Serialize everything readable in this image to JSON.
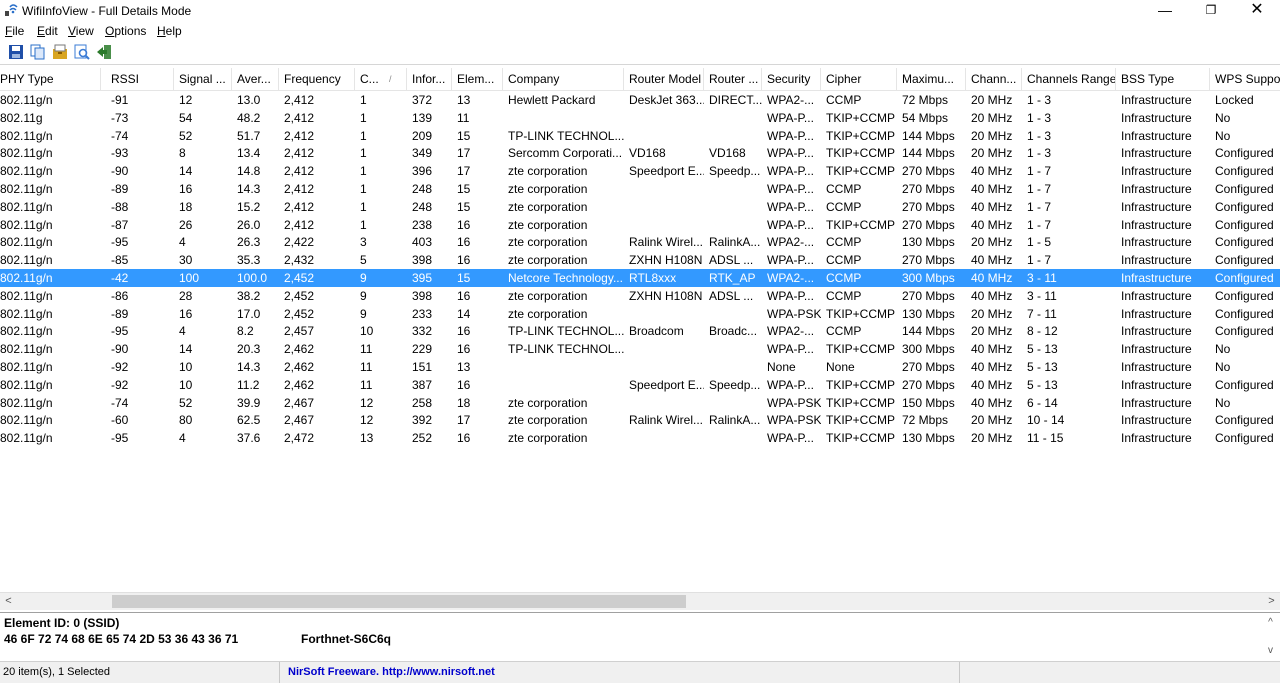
{
  "window": {
    "title": "WifiInfoView  -  Full Details Mode",
    "minimize_glyph": "—",
    "maximize_glyph": "❐",
    "close_glyph": "✕"
  },
  "menu": [
    {
      "label": "File",
      "key": "F",
      "rest": "ile"
    },
    {
      "label": "Edit",
      "key": "E",
      "rest": "dit"
    },
    {
      "label": "View",
      "key": "V",
      "rest": "iew"
    },
    {
      "label": "Options",
      "key": "O",
      "rest": "ptions"
    },
    {
      "label": "Help",
      "key": "H",
      "rest": "elp"
    }
  ],
  "toolbar": {
    "icons": [
      "save-icon",
      "copy-icon",
      "properties-icon",
      "find-icon",
      "exit-icon"
    ],
    "colors": {
      "save": "#1f4fa8",
      "copy": "#2a6fc9",
      "properties": "#d9a520",
      "find": "#3a7bd5",
      "exit": "#2b7a2b"
    }
  },
  "colors": {
    "selection": "#3399ff",
    "header_border": "#e5e5e5",
    "statusbar": "#f0f0f0",
    "link": "#0000cc"
  },
  "table": {
    "columns": [
      "PHY Type",
      "RSSI",
      "Signal ...",
      "Aver...",
      "Frequency",
      "C...",
      "Infor...",
      "Elem...",
      "Company",
      "Router Model",
      "Router ...",
      "Security",
      "Cipher",
      "Maximu...",
      "Chann...",
      "Channels Range",
      "BSS Type",
      "WPS Support"
    ],
    "sort_indicator": "/",
    "rows": [
      {
        "selected": false,
        "cells": [
          "802.11g/n",
          "-91",
          "12",
          "13.0",
          "2,412",
          "1",
          "372",
          "13",
          "Hewlett Packard",
          "DeskJet 363...",
          "DIRECT...",
          "WPA2-...",
          "CCMP",
          "72 Mbps",
          "20 MHz",
          "1 - 3",
          "Infrastructure",
          "Locked"
        ]
      },
      {
        "selected": false,
        "cells": [
          "802.11g",
          "-73",
          "54",
          "48.2",
          "2,412",
          "1",
          "139",
          "11",
          "",
          "",
          "",
          "WPA-P...",
          "TKIP+CCMP",
          "54 Mbps",
          "20 MHz",
          "1 - 3",
          "Infrastructure",
          "No"
        ]
      },
      {
        "selected": false,
        "cells": [
          "802.11g/n",
          "-74",
          "52",
          "51.7",
          "2,412",
          "1",
          "209",
          "15",
          "TP-LINK TECHNOL...",
          "",
          "",
          "WPA-P...",
          "TKIP+CCMP",
          "144 Mbps",
          "20 MHz",
          "1 - 3",
          "Infrastructure",
          "No"
        ]
      },
      {
        "selected": false,
        "cells": [
          "802.11g/n",
          "-93",
          "8",
          "13.4",
          "2,412",
          "1",
          "349",
          "17",
          "Sercomm Corporati...",
          "VD168",
          "VD168",
          "WPA-P...",
          "TKIP+CCMP",
          "144 Mbps",
          "20 MHz",
          "1 - 3",
          "Infrastructure",
          "Configured"
        ]
      },
      {
        "selected": false,
        "cells": [
          "802.11g/n",
          "-90",
          "14",
          "14.8",
          "2,412",
          "1",
          "396",
          "17",
          "zte corporation",
          "Speedport E...",
          "Speedp...",
          "WPA-P...",
          "TKIP+CCMP",
          "270 Mbps",
          "40 MHz",
          "1 - 7",
          "Infrastructure",
          "Configured"
        ]
      },
      {
        "selected": false,
        "cells": [
          "802.11g/n",
          "-89",
          "16",
          "14.3",
          "2,412",
          "1",
          "248",
          "15",
          "zte corporation",
          "",
          "",
          "WPA-P...",
          "CCMP",
          "270 Mbps",
          "40 MHz",
          "1 - 7",
          "Infrastructure",
          "Configured"
        ]
      },
      {
        "selected": false,
        "cells": [
          "802.11g/n",
          "-88",
          "18",
          "15.2",
          "2,412",
          "1",
          "248",
          "15",
          "zte corporation",
          "",
          "",
          "WPA-P...",
          "CCMP",
          "270 Mbps",
          "40 MHz",
          "1 - 7",
          "Infrastructure",
          "Configured"
        ]
      },
      {
        "selected": false,
        "cells": [
          "802.11g/n",
          "-87",
          "26",
          "26.0",
          "2,412",
          "1",
          "238",
          "16",
          "zte corporation",
          "",
          "",
          "WPA-P...",
          "TKIP+CCMP",
          "270 Mbps",
          "40 MHz",
          "1 - 7",
          "Infrastructure",
          "Configured"
        ]
      },
      {
        "selected": false,
        "cells": [
          "802.11g/n",
          "-95",
          "4",
          "26.3",
          "2,422",
          "3",
          "403",
          "16",
          "zte corporation",
          "Ralink Wirel...",
          "RalinkA...",
          "WPA2-...",
          "CCMP",
          "130 Mbps",
          "20 MHz",
          "1 - 5",
          "Infrastructure",
          "Configured"
        ]
      },
      {
        "selected": false,
        "cells": [
          "802.11g/n",
          "-85",
          "30",
          "35.3",
          "2,432",
          "5",
          "398",
          "16",
          "zte corporation",
          "ZXHN H108N",
          "ADSL ...",
          "WPA-P...",
          "CCMP",
          "270 Mbps",
          "40 MHz",
          "1 - 7",
          "Infrastructure",
          "Configured"
        ]
      },
      {
        "selected": true,
        "cells": [
          "802.11g/n",
          "-42",
          "100",
          "100.0",
          "2,452",
          "9",
          "395",
          "15",
          "Netcore Technology...",
          "RTL8xxx",
          "RTK_AP",
          "WPA2-...",
          "CCMP",
          "300 Mbps",
          "40 MHz",
          "3 - 11",
          "Infrastructure",
          "Configured"
        ]
      },
      {
        "selected": false,
        "cells": [
          "802.11g/n",
          "-86",
          "28",
          "38.2",
          "2,452",
          "9",
          "398",
          "16",
          "zte corporation",
          "ZXHN H108N",
          "ADSL ...",
          "WPA-P...",
          "CCMP",
          "270 Mbps",
          "40 MHz",
          "3 - 11",
          "Infrastructure",
          "Configured"
        ]
      },
      {
        "selected": false,
        "cells": [
          "802.11g/n",
          "-89",
          "16",
          "17.0",
          "2,452",
          "9",
          "233",
          "14",
          "zte corporation",
          "",
          "",
          "WPA-PSK",
          "TKIP+CCMP",
          "130 Mbps",
          "20 MHz",
          "7 - 11",
          "Infrastructure",
          "Configured"
        ]
      },
      {
        "selected": false,
        "cells": [
          "802.11g/n",
          "-95",
          "4",
          "8.2",
          "2,457",
          "10",
          "332",
          "16",
          "TP-LINK TECHNOL...",
          "Broadcom",
          "Broadc...",
          "WPA2-...",
          "CCMP",
          "144 Mbps",
          "20 MHz",
          "8 - 12",
          "Infrastructure",
          "Configured"
        ]
      },
      {
        "selected": false,
        "cells": [
          "802.11g/n",
          "-90",
          "14",
          "20.3",
          "2,462",
          "11",
          "229",
          "16",
          "TP-LINK TECHNOL...",
          "",
          "",
          "WPA-P...",
          "TKIP+CCMP",
          "300 Mbps",
          "40 MHz",
          "5 - 13",
          "Infrastructure",
          "No"
        ]
      },
      {
        "selected": false,
        "cells": [
          "802.11g/n",
          "-92",
          "10",
          "14.3",
          "2,462",
          "11",
          "151",
          "13",
          "",
          "",
          "",
          "None",
          "None",
          "270 Mbps",
          "40 MHz",
          "5 - 13",
          "Infrastructure",
          "No"
        ]
      },
      {
        "selected": false,
        "cells": [
          "802.11g/n",
          "-92",
          "10",
          "11.2",
          "2,462",
          "11",
          "387",
          "16",
          "",
          "Speedport E...",
          "Speedp...",
          "WPA-P...",
          "TKIP+CCMP",
          "270 Mbps",
          "40 MHz",
          "5 - 13",
          "Infrastructure",
          "Configured"
        ]
      },
      {
        "selected": false,
        "cells": [
          "802.11g/n",
          "-74",
          "52",
          "39.9",
          "2,467",
          "12",
          "258",
          "18",
          "zte corporation",
          "",
          "",
          "WPA-PSK",
          "TKIP+CCMP",
          "150 Mbps",
          "40 MHz",
          "6 - 14",
          "Infrastructure",
          "No"
        ]
      },
      {
        "selected": false,
        "cells": [
          "802.11g/n",
          "-60",
          "80",
          "62.5",
          "2,467",
          "12",
          "392",
          "17",
          "zte corporation",
          "Ralink Wirel...",
          "RalinkA...",
          "WPA-PSK",
          "TKIP+CCMP",
          "72 Mbps",
          "20 MHz",
          "10 - 14",
          "Infrastructure",
          "Configured"
        ]
      },
      {
        "selected": false,
        "cells": [
          "802.11g/n",
          "-95",
          "4",
          "37.6",
          "2,472",
          "13",
          "252",
          "16",
          "zte corporation",
          "",
          "",
          "WPA-P...",
          "TKIP+CCMP",
          "130 Mbps",
          "20 MHz",
          "11 - 15",
          "Infrastructure",
          "Configured"
        ]
      }
    ]
  },
  "lower_pane": {
    "element_line": "Element ID: 0  (SSID)",
    "hex": "46 6F 72 74 68 6E 65 74 2D 53 36 43 36 71",
    "ascii": "Forthnet-S6C6q"
  },
  "statusbar": {
    "items": "20 item(s), 1 Selected",
    "link": "NirSoft Freeware.  http://www.nirsoft.net"
  }
}
